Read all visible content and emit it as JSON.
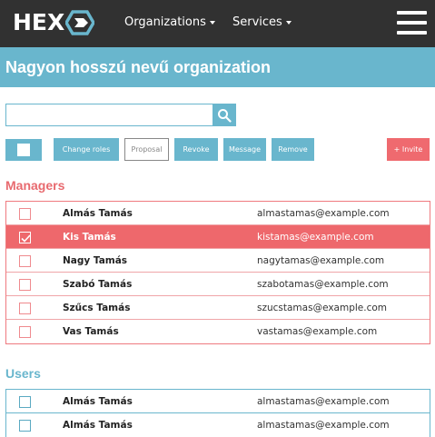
{
  "navbar": {
    "logo_text": "HEX",
    "logo_icon": "hex-arrow-logo-icon",
    "organizations_label": "Organizations",
    "services_label": "Services",
    "menu_icon": "hamburger-menu-icon"
  },
  "header": {
    "title": "Nagyon hosszú nevű organization"
  },
  "search": {
    "value": "",
    "placeholder": "",
    "icon": "search-icon"
  },
  "toolbar": {
    "change_roles_label": "Change roles",
    "proposal_label": "Proposal",
    "revoke_label": "Revoke",
    "message_label": "Message",
    "remove_label": "Remove",
    "invite_label": "+ Invite"
  },
  "managers": {
    "heading": "Managers",
    "rows": [
      {
        "name": "Almás Tamás",
        "email": "almastamas@example.com",
        "checked": false
      },
      {
        "name": "Kis Tamás",
        "email": "kistamas@example.com",
        "checked": true
      },
      {
        "name": "Nagy Tamás",
        "email": "nagytamas@example.com",
        "checked": false
      },
      {
        "name": "Szabó Tamás",
        "email": "szabotamas@example.com",
        "checked": false
      },
      {
        "name": "Szűcs Tamás",
        "email": "szucstamas@example.com",
        "checked": false
      },
      {
        "name": "Vas Tamás",
        "email": "vastamas@example.com",
        "checked": false
      }
    ]
  },
  "users": {
    "heading": "Users",
    "rows": [
      {
        "name": "Almás Tamás",
        "email": "almastamas@example.com",
        "checked": false
      },
      {
        "name": "Almás Tamás",
        "email": "almastamas@example.com",
        "checked": false
      }
    ]
  },
  "colors": {
    "navbar": "#313131",
    "accent_blue": "#69b6cd",
    "accent_red": "#ef6a6f"
  }
}
